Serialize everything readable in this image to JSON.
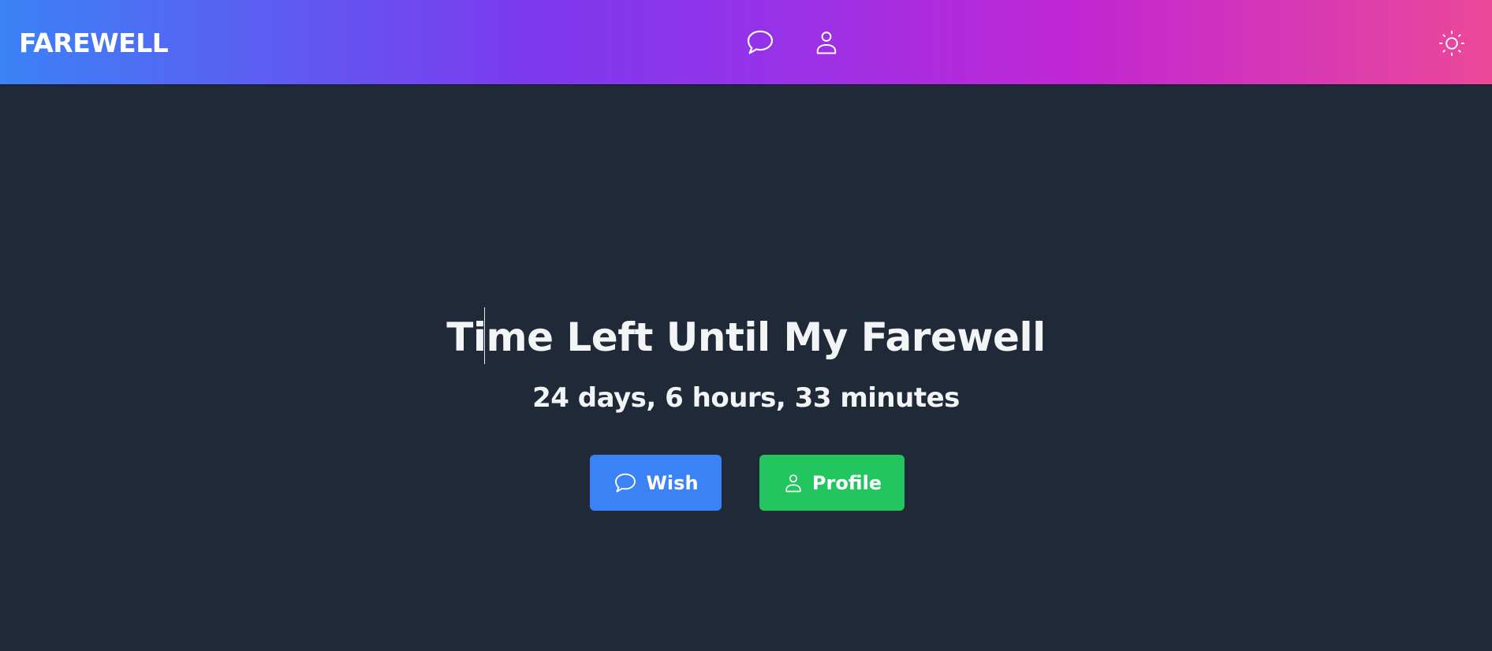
{
  "header": {
    "brand": "FAREWELL",
    "icons": [
      "chat-bubble-icon",
      "user-icon",
      "sun-icon"
    ]
  },
  "hero": {
    "title": "Time Left Until My Farewell",
    "countdown": "24 days, 6 hours, 33 minutes",
    "buttons": {
      "wish": {
        "label": "Wish",
        "icon": "chat-bubble-icon",
        "color": "#3b82f6"
      },
      "profile": {
        "label": "Profile",
        "icon": "user-icon",
        "color": "#22c55e"
      }
    }
  },
  "colors": {
    "background": "#1f2937",
    "header_gradient": [
      "#3b82f6",
      "#9333ea",
      "#ec4899"
    ],
    "text": "#f3f4f6"
  }
}
